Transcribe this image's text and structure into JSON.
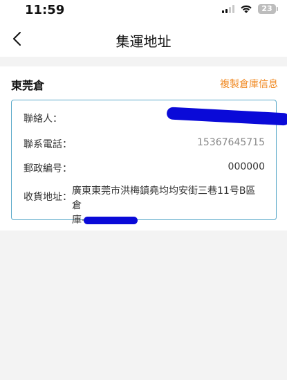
{
  "status_bar": {
    "time": "11:59",
    "battery": "23"
  },
  "nav": {
    "title": "集運地址",
    "back_icon": "chevron-left-icon"
  },
  "warehouse": {
    "name": "東莞倉",
    "copy_label": "複製倉庫信息",
    "contact_label": "聯絡人：",
    "phone_label": "聯系電話：",
    "phone_value": "15367645715",
    "postal_label": "郵政編号：",
    "postal_value": "000000",
    "address_label": "收貨地址：",
    "address_value_line1": "廣東東莞市洪梅鎮堯均均安街三巷11号B區倉",
    "address_value_line2_prefix": "庫-"
  },
  "colors": {
    "accent": "#f08a24",
    "card_border": "#5aa9c9",
    "redaction": "#0a0ad8"
  }
}
